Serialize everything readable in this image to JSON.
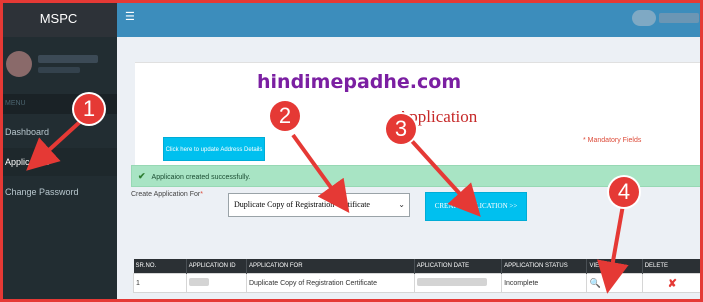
{
  "sidebar": {
    "brand": "MSPC",
    "header": "MENU",
    "items": [
      {
        "label": "Dashboard"
      },
      {
        "label": "Application"
      },
      {
        "label": "Change Password"
      }
    ]
  },
  "topbar": {
    "menu_icon": "hamburger-icon"
  },
  "watermark": "hindimepadhe.com",
  "page": {
    "title": "Application",
    "update_button": "Click here to update Address Details",
    "mandatory": "* Mandatory Fields"
  },
  "alert": {
    "icon": "check-icon",
    "text": "Applicaion created successfully."
  },
  "form": {
    "label": "Create Application For",
    "required_mark": "*",
    "selected": "Duplicate Copy of Registration Certificate",
    "create_button": "CREATE APPLICATION >>"
  },
  "table": {
    "headers": [
      "SR.NO.",
      "APPLICATION ID",
      "APPLICATION FOR",
      "APLICATION DATE",
      "APPLICATION STATUS",
      "VIEW",
      "DELETE"
    ],
    "rows": [
      {
        "sr": "1",
        "app_for": "Duplicate Copy of Registration Certificate",
        "status": "Incomplete",
        "view_icon": "magnifier-icon",
        "delete_icon": "delete-x-icon"
      }
    ]
  },
  "annotations": [
    "1",
    "2",
    "3",
    "4"
  ],
  "colors": {
    "accent": "#3c8dbc",
    "sidebar": "#222d32",
    "button": "#00c0ef",
    "success": "#a8e4c4",
    "annotation": "#e53935"
  }
}
